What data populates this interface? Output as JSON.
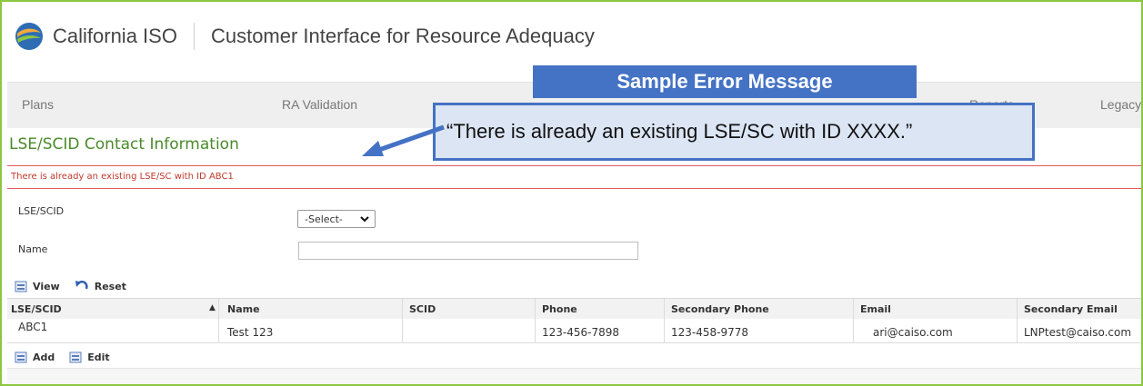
{
  "header": {
    "brand": "California ISO",
    "app_title": "Customer Interface for Resource Adequacy"
  },
  "nav": {
    "items": [
      "Plans",
      "RA Validation",
      "Reports",
      "Legacy"
    ]
  },
  "page": {
    "title": "LSE/SCID Contact Information",
    "error_message": "There is already an existing LSE/SC with ID  ABC1"
  },
  "form": {
    "lse_label": "LSE/SCID",
    "lse_select_value": "-Select-",
    "name_label": "Name",
    "name_value": ""
  },
  "toolbar_top": {
    "view_label": "View",
    "reset_label": "Reset"
  },
  "table": {
    "columns": [
      "LSE/SCID",
      "Name",
      "SCID",
      "Phone",
      "Secondary Phone",
      "Email",
      "Secondary Email"
    ],
    "sort_indicator": "▲",
    "rows": [
      [
        "ABC1",
        "Test 123",
        "",
        "123-456-7898",
        "123-458-9778",
        "ari@caiso.com",
        "LNPtest@caiso.com"
      ]
    ]
  },
  "toolbar_bottom": {
    "add_label": "Add",
    "edit_label": "Edit"
  },
  "callout": {
    "title": "Sample Error Message",
    "text": "“There is already an existing LSE/SC with ID XXXX.”"
  },
  "colors": {
    "frame_border": "#8dc63f",
    "title_green": "#4a8a2a",
    "error_red": "#c0392b",
    "callout_blue": "#4472c4",
    "callout_fill": "#dbe5f4"
  },
  "icons": [
    "caiso-logo-icon",
    "view-icon",
    "reset-icon",
    "add-icon",
    "edit-icon",
    "chevron-down-icon",
    "sort-asc-icon"
  ]
}
